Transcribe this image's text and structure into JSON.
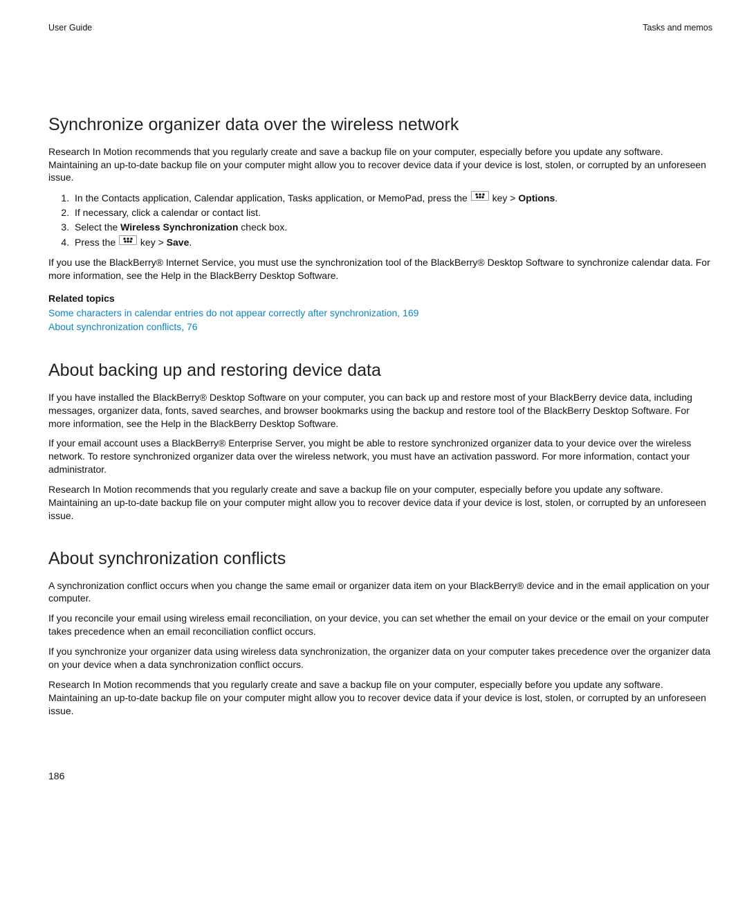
{
  "header": {
    "left": "User Guide",
    "right": "Tasks and memos"
  },
  "section1": {
    "title": "Synchronize organizer data over the wireless network",
    "intro": "Research In Motion recommends that you regularly create and save a backup file on your computer, especially before you update any software. Maintaining an up-to-date backup file on your computer might allow you to recover device data if your device is lost, stolen, or corrupted by an unforeseen issue.",
    "step1_pre": "In the Contacts application, Calendar application, Tasks application, or MemoPad, press the ",
    "step1_mid": " key > ",
    "step1_bold": "Options",
    "step1_post": ".",
    "step2": "If necessary, click a calendar or contact list.",
    "step3_pre": "Select the ",
    "step3_bold": "Wireless Synchronization",
    "step3_post": " check box.",
    "step4_pre": "Press the ",
    "step4_mid": " key > ",
    "step4_bold": "Save",
    "step4_post": ".",
    "outro": "If you use the BlackBerry® Internet Service, you must use the synchronization tool of the BlackBerry® Desktop Software to synchronize calendar data. For more information, see the Help in the BlackBerry Desktop Software.",
    "related_label": "Related topics",
    "link1": "Some characters in calendar entries do not appear correctly after synchronization, 169",
    "link2": "About synchronization conflicts, 76"
  },
  "section2": {
    "title": "About backing up and restoring device data",
    "p1": "If you have installed the BlackBerry® Desktop Software on your computer, you can back up and restore most of your BlackBerry device data, including messages, organizer data, fonts, saved searches, and browser bookmarks using the backup and restore tool of the BlackBerry Desktop Software. For more information, see the Help in the BlackBerry Desktop Software.",
    "p2": "If your email account uses a BlackBerry® Enterprise Server, you might be able to restore synchronized organizer data to your device over the wireless network. To restore synchronized organizer data over the wireless network, you must have an activation password. For more information, contact your administrator.",
    "p3": "Research In Motion recommends that you regularly create and save a backup file on your computer, especially before you update any software. Maintaining an up-to-date backup file on your computer might allow you to recover device data if your device is lost, stolen, or corrupted by an unforeseen issue."
  },
  "section3": {
    "title": "About synchronization conflicts",
    "p1": "A synchronization conflict occurs when you change the same email or organizer data item on your BlackBerry® device and in the email application on your computer.",
    "p2": "If you reconcile your email using wireless email reconciliation, on your device, you can set whether the email on your device or the email on your computer takes precedence when an email reconciliation conflict occurs.",
    "p3": "If you synchronize your organizer data using wireless data synchronization, the organizer data on your computer takes precedence over the organizer data on your device when a data synchronization conflict occurs.",
    "p4": "Research In Motion recommends that you regularly create and save a backup file on your computer, especially before you update any software. Maintaining an up-to-date backup file on your computer might allow you to recover device data if your device is lost, stolen, or corrupted by an unforeseen issue."
  },
  "page_number": "186"
}
